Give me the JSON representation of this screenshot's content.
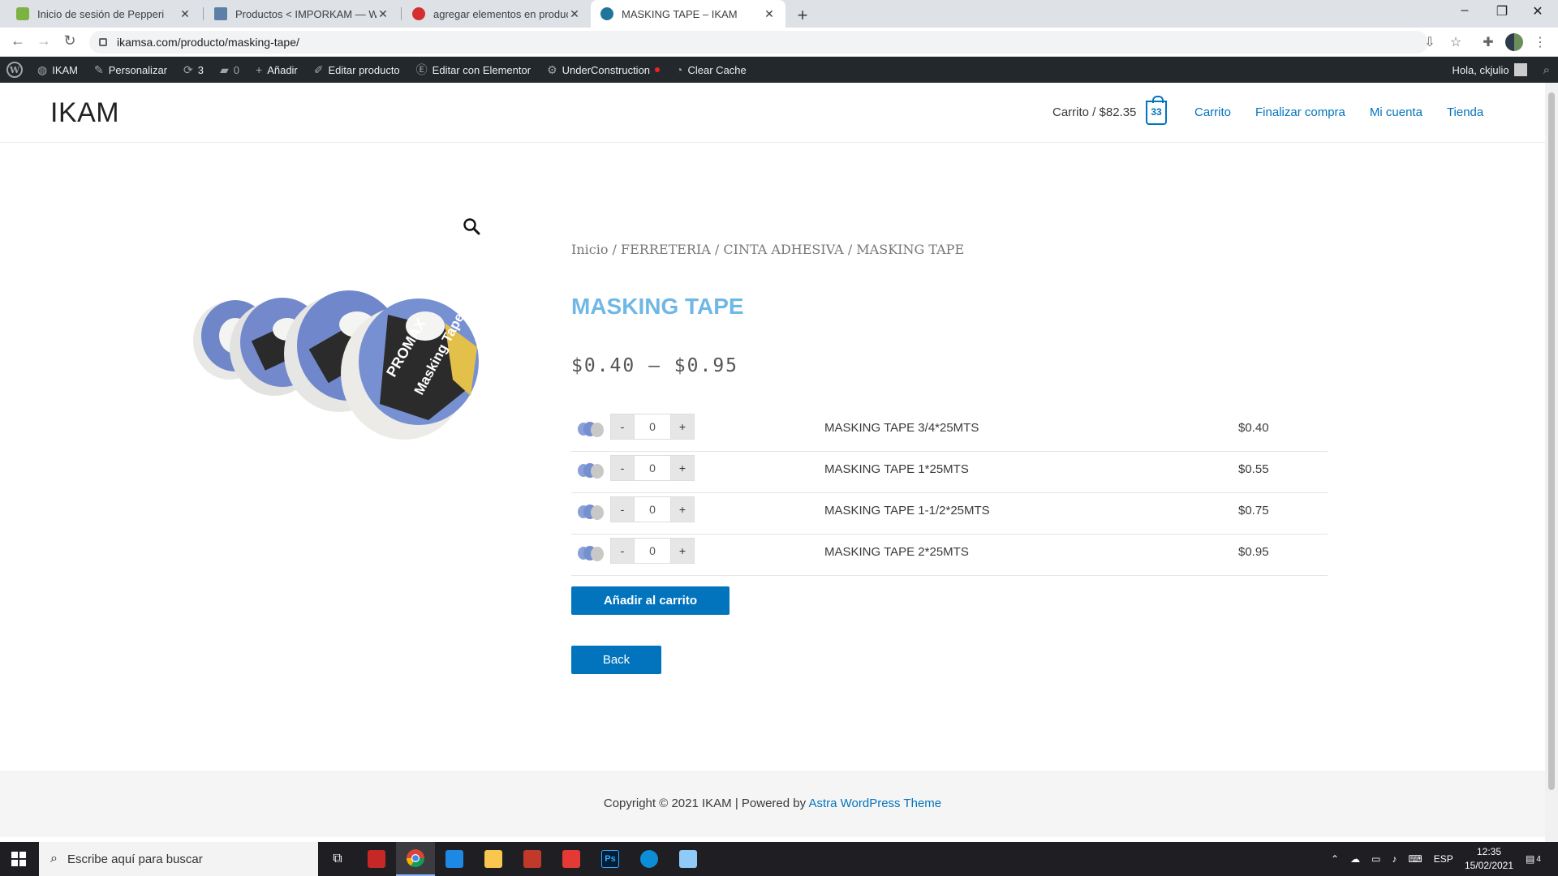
{
  "browser": {
    "tabs": [
      {
        "title": "Inicio de sesión de Pepperi",
        "favicon_color": "#7cb342",
        "active": false
      },
      {
        "title": "Productos < IMPORKAM — WordPress",
        "favicon_color": "#5b7fa6",
        "active": false
      },
      {
        "title": "agregar elementos en productos",
        "favicon_color": "#d32f2f",
        "active": false
      },
      {
        "title": "MASKING TAPE – IKAM",
        "favicon_color": "#21759b",
        "active": true
      }
    ],
    "url": "ikamsa.com/producto/masking-tape/"
  },
  "adminbar": {
    "items": [
      {
        "label": "IKAM",
        "icon": "dashboard-icon"
      },
      {
        "label": "Personalizar",
        "icon": "brush-icon"
      },
      {
        "label": "3",
        "icon": "updates-icon"
      },
      {
        "label": "0",
        "icon": "comments-icon"
      },
      {
        "label": "Añadir",
        "icon": "plus-icon"
      },
      {
        "label": "Editar producto",
        "icon": "pencil-icon"
      },
      {
        "label": "Editar con Elementor",
        "icon": "elementor-icon"
      },
      {
        "label": "UnderConstruction",
        "icon": "gear-icon"
      },
      {
        "label": "Clear Cache",
        "icon": "speedometer-icon"
      }
    ],
    "greeting": "Hola, ckjulio"
  },
  "site": {
    "title": "IKAM",
    "cart_total": "Carrito / $82.35",
    "cart_count": "33",
    "nav": [
      "Carrito",
      "Finalizar compra",
      "Mi cuenta",
      "Tienda"
    ]
  },
  "product": {
    "breadcrumb": "Inicio / FERRETERIA / CINTA ADHESIVA / MASKING TAPE",
    "title": "MASKING TAPE",
    "price_range": "$0.40 – $0.95",
    "variations": [
      {
        "name": "MASKING TAPE 3/4*25MTS",
        "price": "$0.40",
        "qty": "0"
      },
      {
        "name": "MASKING TAPE 1*25MTS",
        "price": "$0.55",
        "qty": "0"
      },
      {
        "name": "MASKING TAPE 1-1/2*25MTS",
        "price": "$0.75",
        "qty": "0"
      },
      {
        "name": "MASKING TAPE 2*25MTS",
        "price": "$0.95",
        "qty": "0"
      }
    ],
    "add_to_cart": "Añadir al carrito",
    "back": "Back",
    "brand_on_package": "PROMAX",
    "package_text": "Masking Tape"
  },
  "footer": {
    "copyright": "Copyright © 2021 IKAM | Powered by ",
    "theme_link": "Astra WordPress Theme"
  },
  "taskbar": {
    "search_placeholder": "Escribe aquí para buscar",
    "language": "ESP",
    "time": "12:35",
    "date": "15/02/2021",
    "notifications": "4"
  }
}
